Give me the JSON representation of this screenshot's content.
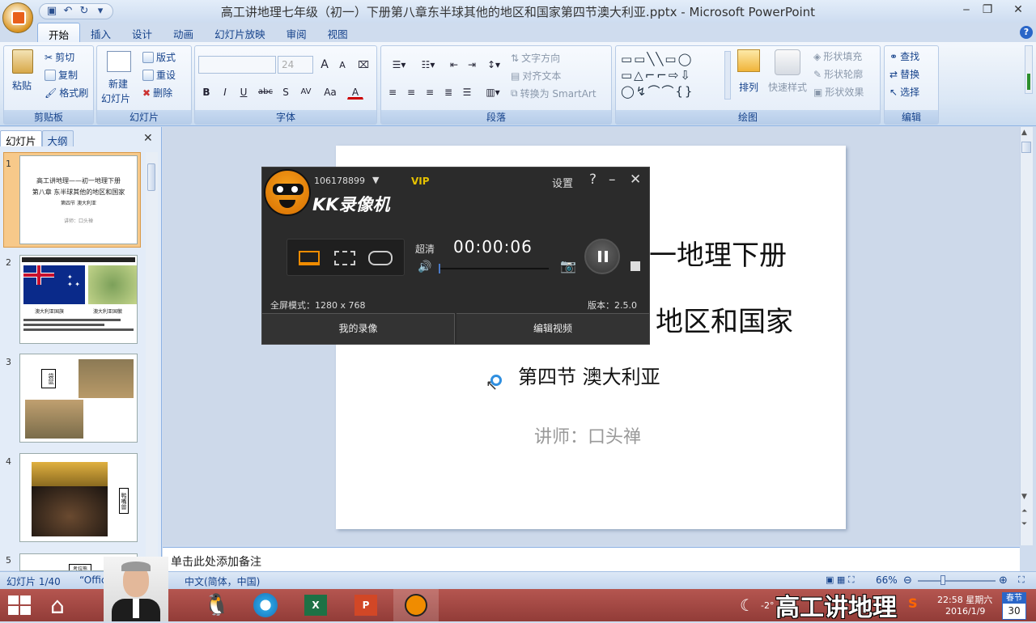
{
  "window": {
    "title": "高工讲地理七年级（初一）下册第八章东半球其他的地区和国家第四节澳大利亚.pptx - Microsoft PowerPoint",
    "minimize": "‒",
    "maximize": "❐",
    "close": "✕"
  },
  "ribbon": {
    "tabs": [
      "开始",
      "插入",
      "设计",
      "动画",
      "幻灯片放映",
      "审阅",
      "视图"
    ],
    "clipboard": {
      "paste": "粘贴",
      "cut": "剪切",
      "copy": "复制",
      "format_painter": "格式刷",
      "label": "剪贴板"
    },
    "slides": {
      "new_slide": "新建",
      "new_slide2": "幻灯片",
      "layout": "版式",
      "reset": "重设",
      "delete": "删除",
      "label": "幻灯片"
    },
    "font": {
      "font_size": "24",
      "label": "字体",
      "bold": "B",
      "italic": "I",
      "underline": "U",
      "strike": "abc",
      "shadow": "S",
      "spacing": "AV",
      "case": "Aa",
      "color": "A",
      "grow": "A",
      "shrink": "A"
    },
    "paragraph": {
      "text_direction": "文字方向",
      "align_text": "对齐文本",
      "smartart": "转换为 SmartArt",
      "label": "段落"
    },
    "drawing": {
      "arrange": "排列",
      "quick_styles": "快速样式",
      "shape_fill": "形状填充",
      "shape_outline": "形状轮廓",
      "shape_effects": "形状效果",
      "label": "绘图"
    },
    "editing": {
      "find": "查找",
      "replace": "替换",
      "select": "选择",
      "label": "编辑"
    }
  },
  "panel": {
    "tabs": [
      "幻灯片",
      "大纲"
    ],
    "close": "✕",
    "thumbnails": [
      {
        "num": "1",
        "lines": [
          "高工讲地理——初一地理下册",
          "第八章 东半球其他的地区和国家",
          "第四节 澳大利亚",
          "讲师：口头禅"
        ]
      },
      {
        "num": "2",
        "caption_left": "澳大利亚国旗",
        "caption_right": "澳大利亚国徽"
      },
      {
        "num": "3",
        "caption": "袋鼠"
      },
      {
        "num": "4",
        "caption": "鸭嘴兽"
      },
      {
        "num": "5",
        "caption": "考拉熊"
      }
    ]
  },
  "slide": {
    "line1": "一地理下册",
    "line2": "地区和国家",
    "line3": "第四节 澳大利亚",
    "line4": "讲师：口头禅"
  },
  "notes": {
    "placeholder": "单击此处添加备注"
  },
  "status": {
    "slide_count": "幻灯片 1/40",
    "theme": "“Offic",
    "language": "中文(简体，中国)",
    "zoom": "66%"
  },
  "kk": {
    "user_id": "106178899",
    "vip": "VIP",
    "settings": "设置",
    "help": "?",
    "minimize": "–",
    "close": "✕",
    "brand": "KK录像机",
    "quality": "超清",
    "timer": "00:00:06",
    "mode": "全屏模式：1280 x 768",
    "version": "版本：2.5.0",
    "my_videos": "我的录像",
    "edit_video": "编辑视频"
  },
  "taskbar": {
    "overlay_title": "高工讲地理",
    "time": "22:58 星期六",
    "date": "2016/1/9",
    "calendar_top": "春节",
    "calendar_day": "30",
    "temp": "-2°"
  },
  "colors": {
    "accent": "#15428b",
    "ribbon_bg": "#dbe7f5",
    "taskbar": "#a44a45",
    "kk_orange": "#f08c00"
  }
}
